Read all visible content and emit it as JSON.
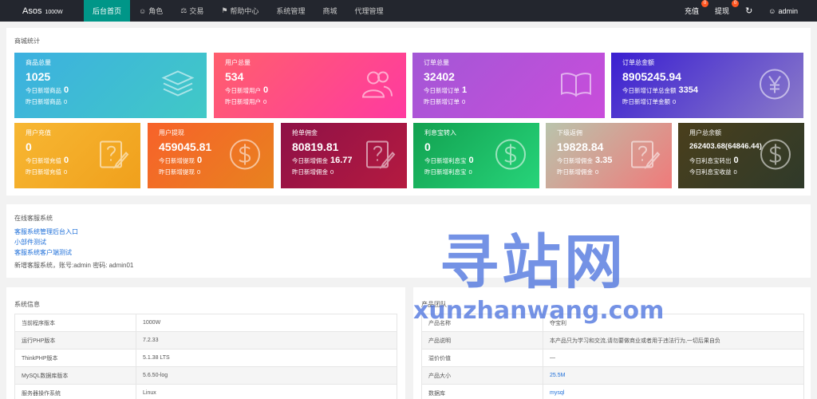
{
  "nav": {
    "brand": "Asos",
    "brand_version": "1000W",
    "items": [
      {
        "label": "后台首页",
        "icon": "",
        "active": true
      },
      {
        "label": "角色",
        "icon": "user-icon"
      },
      {
        "label": "交易",
        "icon": "scale-icon"
      },
      {
        "label": "帮助中心",
        "icon": "flag-icon"
      },
      {
        "label": "系统管理",
        "icon": ""
      },
      {
        "label": "商城",
        "icon": ""
      },
      {
        "label": "代理管理",
        "icon": ""
      }
    ],
    "recharge": {
      "label": "充值",
      "badge": "0"
    },
    "withdraw": {
      "label": "提现",
      "badge": "0"
    },
    "refresh_icon": "refresh-icon",
    "user": "admin"
  },
  "stats": {
    "title": "商城统计",
    "cards": [
      {
        "title": "商品总量",
        "value": "1025",
        "line1": "今日新增商品",
        "line1_val": "0",
        "line2": "昨日新增商品",
        "line2_val": "0",
        "icon": "layers-icon",
        "bg": "linear-gradient(135deg,#3cb0e0,#41c9c6)"
      },
      {
        "title": "用户总量",
        "value": "534",
        "line1": "今日新增用户",
        "line1_val": "0",
        "line2": "昨日新增用户",
        "line2_val": "0",
        "icon": "users-icon",
        "bg": "linear-gradient(135deg,#ff5f6d,#ff3aa0)"
      },
      {
        "title": "订单总量",
        "value": "32402",
        "line1": "今日新增订单",
        "line1_val": "1",
        "line2": "昨日新增订单",
        "line2_val": "0",
        "icon": "book-icon",
        "bg": "linear-gradient(135deg,#a357d6,#c94ddb)"
      },
      {
        "title": "订单总金额",
        "value": "8905245.94",
        "line1": "今日新增订单总金额",
        "line1_val": "3354",
        "line2": "昨日新增订单金额",
        "line2_val": "0",
        "icon": "yen-icon",
        "bg": "linear-gradient(135deg,#3a1fd1,#8b7bc9)"
      },
      {
        "title": "用户充值",
        "value": "0",
        "line1": "今日新增充值",
        "line1_val": "0",
        "line2": "昨日新增充值",
        "line2_val": "0",
        "icon": "question-edit-icon",
        "bg": "linear-gradient(135deg,#f7b733,#f0a01c)"
      },
      {
        "title": "用户提现",
        "value": "459045.81",
        "line1": "今日新增提现",
        "line1_val": "0",
        "line2": "昨日新增提现",
        "line2_val": "0",
        "icon": "dollar-icon",
        "bg": "linear-gradient(135deg,#f7622a,#e8821f)"
      },
      {
        "title": "抢单佣金",
        "value": "80819.81",
        "line1": "今日新增佣金",
        "line1_val": "16.77",
        "line2": "昨日新增佣金",
        "line2_val": "0",
        "icon": "question-edit-icon",
        "bg": "linear-gradient(135deg,#8e1147,#b51a40)"
      },
      {
        "title": "利息宝转入",
        "value": "0",
        "line1": "今日新增利息宝",
        "line1_val": "0",
        "line2": "昨日新增利息宝",
        "line2_val": "0",
        "icon": "dollar-icon",
        "bg": "linear-gradient(135deg,#12a150,#27d47a)"
      },
      {
        "title": "下级返佣",
        "value": "19828.84",
        "line1": "今日新增佣金",
        "line1_val": "3.35",
        "line2": "昨日新增佣金",
        "line2_val": "0",
        "icon": "question-edit-icon",
        "bg": "linear-gradient(135deg,#b9c4ac,#f07a7a)"
      },
      {
        "title": "用户总余额",
        "value": "262403.68(64846.44)",
        "line1": "今日利息宝转出",
        "line1_val": "0",
        "line2": "今日利息宝收益",
        "line2_val": "0",
        "icon": "dollar-icon",
        "bg": "linear-gradient(135deg,#4a3f1c,#2f3a2a)"
      }
    ]
  },
  "support": {
    "title": "在线客服系统",
    "links": [
      "客服系统管理后台入口",
      "小部件测试",
      "客服系统客户端测试"
    ],
    "note": "新增客服系统，账号:admin 密码: admin01"
  },
  "sysinfo": {
    "title": "系统信息",
    "rows": [
      [
        "当前程序版本",
        "1000W"
      ],
      [
        "运行PHP版本",
        "7.2.33"
      ],
      [
        "ThinkPHP版本",
        "5.1.38 LTS"
      ],
      [
        "MySQL数据库版本",
        "5.6.50-log"
      ],
      [
        "服务器操作系统",
        "Linux"
      ]
    ]
  },
  "product": {
    "title": "产品团队",
    "rows": [
      [
        "产品名称",
        "夺宝利"
      ],
      [
        "产品说明",
        "本产品只为学习和交流,请勿要做商业或者用于违法行为,一切后果自负"
      ],
      [
        "溢价价值",
        "—"
      ],
      [
        "产品大小",
        "25.5M"
      ],
      [
        "数据库",
        "mysql"
      ]
    ]
  },
  "watermark": {
    "main": "寻站网",
    "sub": "xunzhanwang.com"
  }
}
